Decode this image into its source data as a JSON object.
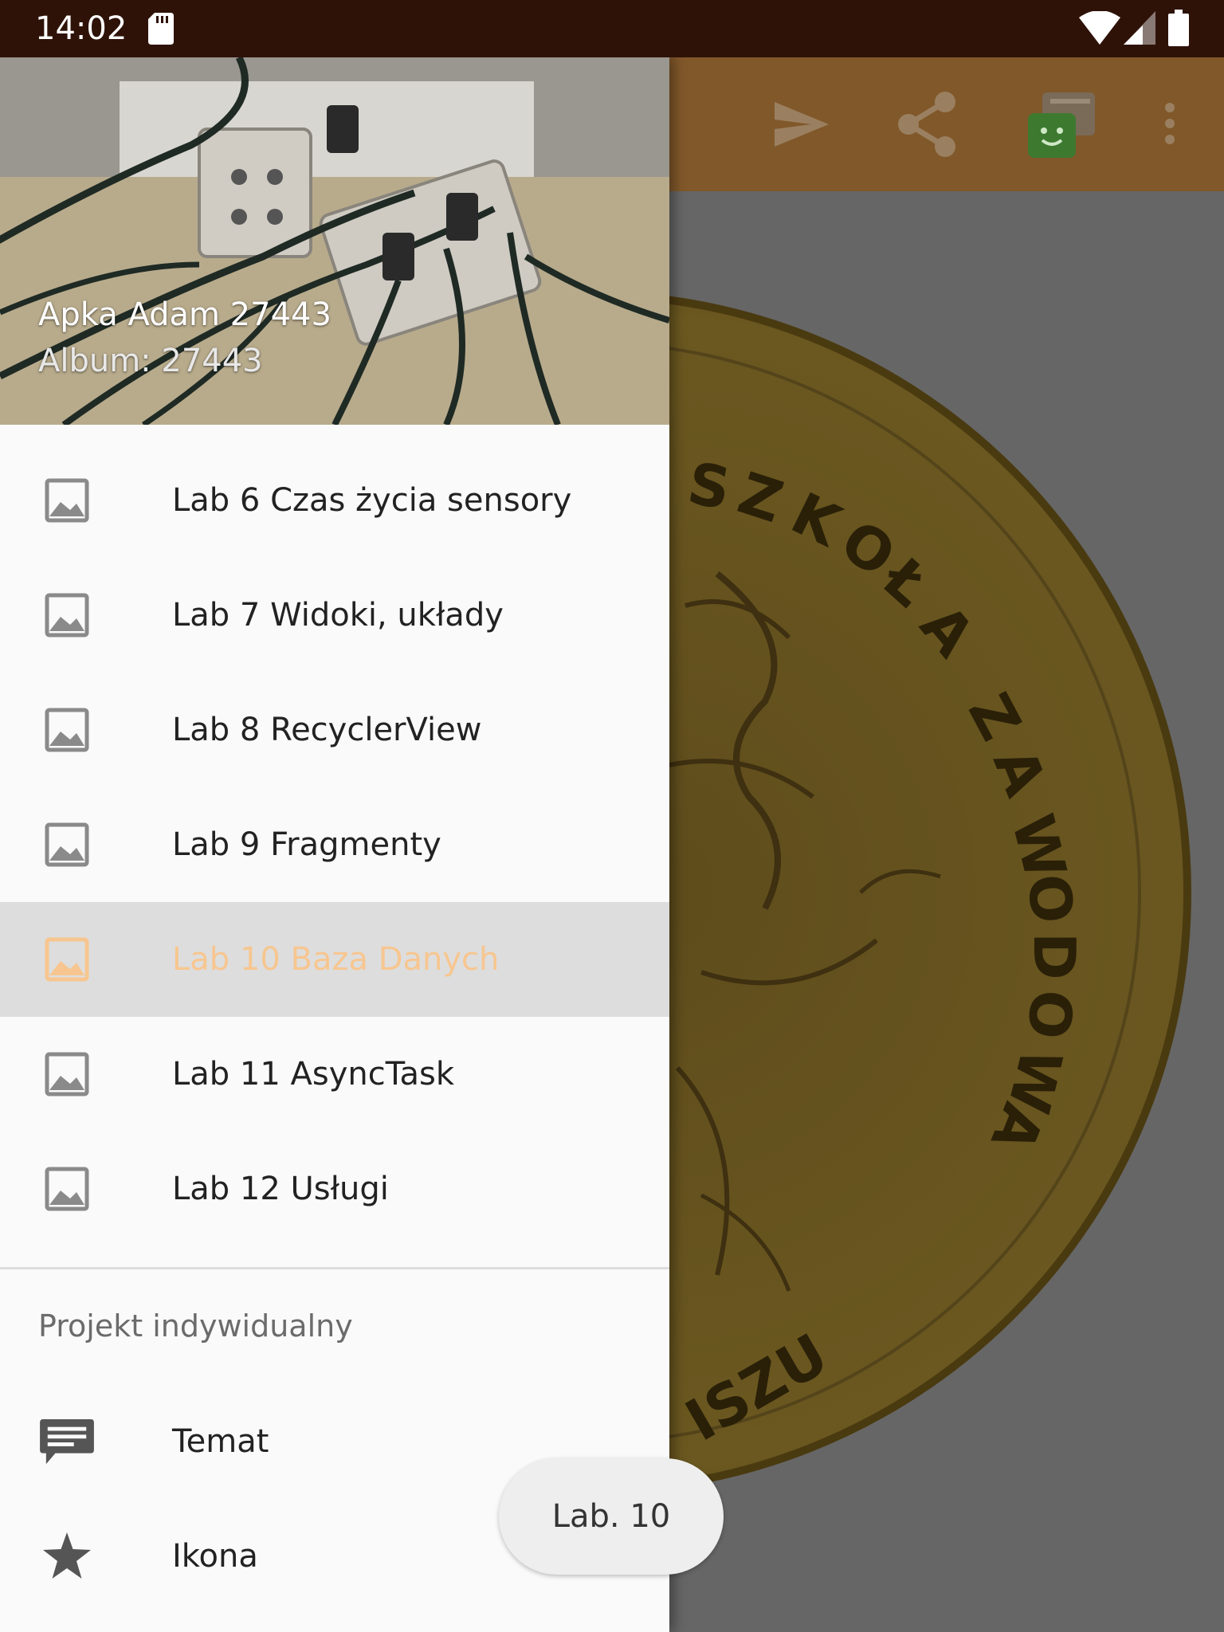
{
  "status_bar": {
    "time": "14:02"
  },
  "app_bar": {
    "actions": [
      "send-icon",
      "share-icon",
      "app-logo-icon",
      "more-icon"
    ],
    "color": "#81582a"
  },
  "background_image": {
    "coin_letters": [
      "S",
      "Z",
      "K",
      "O",
      "Ł",
      "A",
      " ",
      "Z",
      "A",
      "W",
      "O",
      "D",
      "O",
      "W",
      "A"
    ],
    "coin_bottom_text": "ISZU"
  },
  "drawer": {
    "header": {
      "title": "Apka Adam 27443",
      "subtitle": "Album: 27443"
    },
    "items": [
      {
        "label": "Lab 6 Czas życia sensory",
        "icon": "image-icon",
        "checked": false
      },
      {
        "label": "Lab 7 Widoki, układy",
        "icon": "image-icon",
        "checked": false
      },
      {
        "label": "Lab 8 RecyclerView",
        "icon": "image-icon",
        "checked": false
      },
      {
        "label": "Lab 9 Fragmenty",
        "icon": "image-icon",
        "checked": false
      },
      {
        "label": "Lab 10 Baza Danych",
        "icon": "image-icon",
        "checked": true
      },
      {
        "label": "Lab 11 AsyncTask",
        "icon": "image-icon",
        "checked": false
      },
      {
        "label": "Lab 12 Usługi",
        "icon": "image-icon",
        "checked": false
      }
    ],
    "section": {
      "title": "Projekt indywidualny",
      "items": [
        {
          "label": "Temat",
          "icon": "message-icon"
        },
        {
          "label": "Ikona",
          "icon": "star-icon"
        }
      ]
    },
    "accent_color": "#f7c690"
  },
  "toast": {
    "text": "Lab. 10"
  }
}
